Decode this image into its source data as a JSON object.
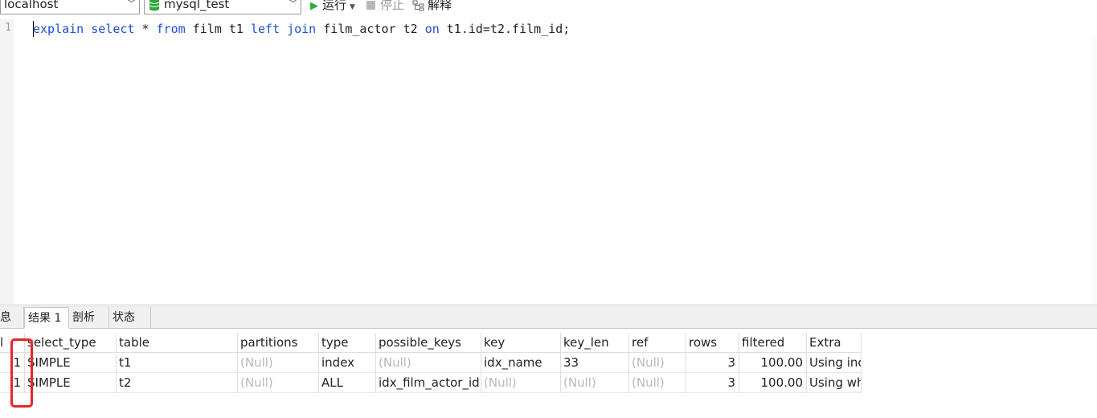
{
  "toolbar": {
    "connection": "localhost",
    "database": "mysql_test",
    "run_label": "运行",
    "stop_label": "停止",
    "explain_label": "解释"
  },
  "editor": {
    "line_number": "1",
    "tokens": [
      {
        "text": "explain",
        "kind": "kw"
      },
      {
        "text": " ",
        "kind": "plain"
      },
      {
        "text": "select",
        "kind": "kw"
      },
      {
        "text": " * ",
        "kind": "plain"
      },
      {
        "text": "from",
        "kind": "kw"
      },
      {
        "text": " film t1 ",
        "kind": "plain"
      },
      {
        "text": "left",
        "kind": "kw"
      },
      {
        "text": " ",
        "kind": "plain"
      },
      {
        "text": "join",
        "kind": "kw"
      },
      {
        "text": " film_actor t2 ",
        "kind": "plain"
      },
      {
        "text": "on",
        "kind": "kw"
      },
      {
        "text": " t1.id=t2.film_id;",
        "kind": "plain"
      }
    ]
  },
  "result_tabs": {
    "info": "息",
    "result1": "结果 1",
    "profile": "剖析",
    "status": "状态"
  },
  "grid": {
    "headers": {
      "id": "l",
      "select_type": "select_type",
      "table": "table",
      "partitions": "partitions",
      "type": "type",
      "possible_keys": "possible_keys",
      "key": "key",
      "key_len": "key_len",
      "ref": "ref",
      "rows": "rows",
      "filtered": "filtered",
      "extra": "Extra"
    },
    "rows": [
      {
        "id": "1",
        "select_type": "SIMPLE",
        "table": "t1",
        "partitions": "(Null)",
        "type": "index",
        "possible_keys": "(Null)",
        "key": "idx_name",
        "key_len": "33",
        "ref": "(Null)",
        "rows": "3",
        "filtered": "100.00",
        "extra": "Using inc"
      },
      {
        "id": "1",
        "select_type": "SIMPLE",
        "table": "t2",
        "partitions": "(Null)",
        "type": "ALL",
        "possible_keys": "idx_film_actor_id",
        "key": "(Null)",
        "key_len": "(Null)",
        "ref": "(Null)",
        "rows": "3",
        "filtered": "100.00",
        "extra": "Using wh"
      }
    ]
  },
  "colors": {
    "keyword": "#1c4fd0",
    "run_icon": "#2eaa3c",
    "highlight_box": "#e8262a",
    "null_text": "#b9b9b9"
  }
}
